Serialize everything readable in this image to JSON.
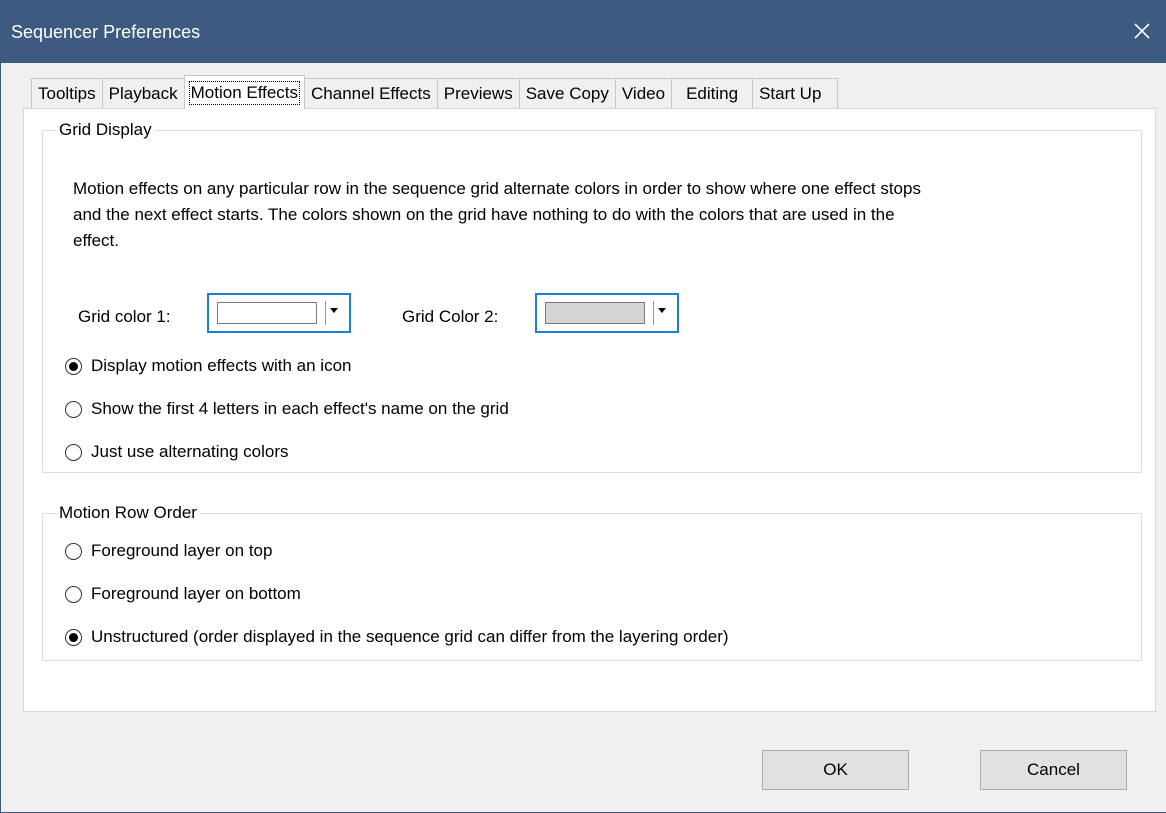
{
  "window": {
    "title": "Sequencer Preferences"
  },
  "tabs": [
    {
      "label": "Tooltips"
    },
    {
      "label": "Playback"
    },
    {
      "label": "Motion Effects"
    },
    {
      "label": "Channel Effects"
    },
    {
      "label": "Previews"
    },
    {
      "label": "Save Copy"
    },
    {
      "label": "Video"
    },
    {
      "label": "Editing"
    },
    {
      "label": "Start Up"
    }
  ],
  "active_tab": "Motion Effects",
  "grid_display": {
    "legend": "Grid Display",
    "description": "Motion effects on any particular row in the sequence grid alternate colors in order to show where one effect stops and the next effect starts. The colors shown on the grid have nothing to do with the colors that are used in the effect.",
    "color1_label": "Grid color 1:",
    "color1_value": "#ffffff",
    "color2_label": "Grid Color 2:",
    "color2_value": "#d4d4d4",
    "options": [
      {
        "label": "Display motion effects with an icon",
        "checked": true
      },
      {
        "label": "Show the first 4 letters in each effect's name on the grid",
        "checked": false
      },
      {
        "label": "Just use alternating colors",
        "checked": false
      }
    ]
  },
  "motion_row_order": {
    "legend": "Motion Row Order",
    "options": [
      {
        "label": "Foreground layer on top",
        "checked": false
      },
      {
        "label": "Foreground layer on bottom",
        "checked": false
      },
      {
        "label": "Unstructured (order displayed in the sequence grid can differ from the layering order)",
        "checked": true
      }
    ]
  },
  "buttons": {
    "ok": "OK",
    "cancel": "Cancel"
  },
  "colors": {
    "titlebar": "#3d5b80",
    "focus_border": "#1b7fd6"
  }
}
